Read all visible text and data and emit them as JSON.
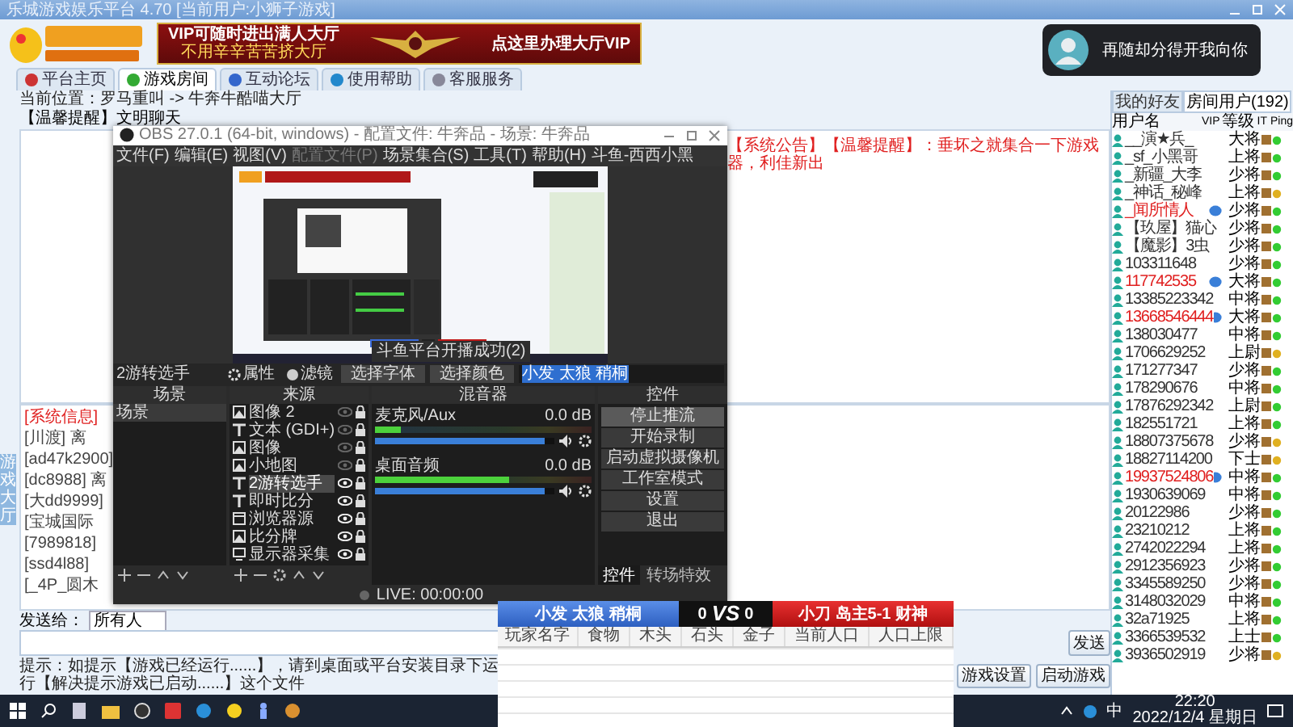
{
  "window": {
    "title": "乐城游戏娱乐平台 4.70 [当前用户:小狮子游戏]"
  },
  "banner": {
    "headline": "VIP可随时进出满人大厅",
    "subline": "不用辛辛苦苦挤大厅",
    "action": "点这里办理大厅VIP"
  },
  "tabs": [
    {
      "label": "平台主页",
      "selected": false
    },
    {
      "label": "游戏房间",
      "selected": true
    },
    {
      "label": "互动论坛",
      "selected": false
    },
    {
      "label": "使用帮助",
      "selected": false
    },
    {
      "label": "客服服务",
      "selected": false
    }
  ],
  "breadcrumb": "当前位置：罗马重叫 -> 牛奔牛酷喵大厅",
  "notice": "【温馨提醒】文明聊天",
  "side_tab": "游戏大厅",
  "announcement": "【系统公告】【温馨提醒】：垂坏之就集合一下游戏器，利佳新出",
  "chat": [
    {
      "text": "[系统信息]",
      "kind": "system"
    },
    {
      "text": "[川渡] 离",
      "kind": "user"
    },
    {
      "text": "[ad47k2900]",
      "kind": "user"
    },
    {
      "text": "[dc8988] 离",
      "kind": "user"
    },
    {
      "text": "[大dd9999]",
      "kind": "user"
    },
    {
      "text": "[宝城国际",
      "kind": "user"
    },
    {
      "text": "[7989818]",
      "kind": "user"
    },
    {
      "text": "[ssd4l88]",
      "kind": "user"
    },
    {
      "text": "[_4P_圆木",
      "kind": "user"
    }
  ],
  "send": {
    "label": "发送给：",
    "target": "所有人",
    "button": "发送"
  },
  "hint": "提示：如提示【游戏已经运行......】，请到桌面或平台安装目录下运行【解决提示游戏已启动......】这个文件",
  "buttons": [
    "游戏设置",
    "启动游戏"
  ],
  "notification": {
    "text": "再随却分得开我向你"
  },
  "user_panel": {
    "tabs": [
      {
        "label": "我的好友",
        "selected": false
      },
      {
        "label": "房间用户(192)",
        "selected": true
      }
    ],
    "columns": [
      "用户名",
      "VIP",
      "等级",
      "IT",
      "Ping"
    ],
    "users": [
      {
        "name": "__演★兵_",
        "vip": false,
        "level": "大将",
        "color": "#33cc33"
      },
      {
        "name": "_sf_小黑哥",
        "vip": false,
        "level": "上将",
        "color": "#33cc33"
      },
      {
        "name": "_新疆_大李",
        "vip": false,
        "level": "少将",
        "color": "#33cc33"
      },
      {
        "name": "_神话_秘峰",
        "vip": false,
        "level": "上将",
        "color": "#e0b020"
      },
      {
        "name": "_闻所情人",
        "vip": true,
        "level": "少将",
        "color": "#33cc33"
      },
      {
        "name": "【玖屋】猫心",
        "vip": false,
        "level": "少将",
        "color": "#33cc33"
      },
      {
        "name": "【魔影】3虫",
        "vip": false,
        "level": "少将",
        "color": "#33cc33"
      },
      {
        "name": "103311648",
        "vip": false,
        "level": "少将",
        "color": "#33cc33"
      },
      {
        "name": "117742535",
        "vip": true,
        "level": "大将",
        "color": "#33cc33"
      },
      {
        "name": "13385223342",
        "vip": false,
        "level": "中将",
        "color": "#33cc33"
      },
      {
        "name": "13668546444",
        "vip": true,
        "level": "大将",
        "color": "#33cc33"
      },
      {
        "name": "138030477",
        "vip": false,
        "level": "中将",
        "color": "#33cc33"
      },
      {
        "name": "1706629252",
        "vip": false,
        "level": "上尉",
        "color": "#e0b020"
      },
      {
        "name": "171277347",
        "vip": false,
        "level": "少将",
        "color": "#33cc33"
      },
      {
        "name": "178290676",
        "vip": false,
        "level": "中将",
        "color": "#33cc33"
      },
      {
        "name": "17876292342",
        "vip": false,
        "level": "上尉",
        "color": "#33cc33"
      },
      {
        "name": "182551721",
        "vip": false,
        "level": "上将",
        "color": "#33cc33"
      },
      {
        "name": "18807375678",
        "vip": false,
        "level": "少将",
        "color": "#e0b020"
      },
      {
        "name": "18827114200",
        "vip": false,
        "level": "下士",
        "color": "#e0b020"
      },
      {
        "name": "19937524806",
        "vip": true,
        "level": "中将",
        "color": "#33cc33"
      },
      {
        "name": "1930639069",
        "vip": false,
        "level": "中将",
        "color": "#33cc33"
      },
      {
        "name": "20122986",
        "vip": false,
        "level": "少将",
        "color": "#33cc33"
      },
      {
        "name": "23210212",
        "vip": false,
        "level": "上将",
        "color": "#33cc33"
      },
      {
        "name": "2742022294",
        "vip": false,
        "level": "上将",
        "color": "#33cc33"
      },
      {
        "name": "2912356923",
        "vip": false,
        "level": "少将",
        "color": "#33cc33"
      },
      {
        "name": "3345589250",
        "vip": false,
        "level": "少将",
        "color": "#33cc33"
      },
      {
        "name": "3148032029",
        "vip": false,
        "level": "中将",
        "color": "#33cc33"
      },
      {
        "name": "32a71925",
        "vip": false,
        "level": "上将",
        "color": "#33cc33"
      },
      {
        "name": "3366539532",
        "vip": false,
        "level": "上士",
        "color": "#33cc33"
      },
      {
        "name": "3936502919",
        "vip": false,
        "level": "少将",
        "color": "#e0b020"
      }
    ]
  },
  "obs": {
    "title": "OBS 27.0.1 (64-bit, windows) - 配置文件: 牛奔品 - 场景: 牛奔品",
    "menu": [
      {
        "label": "文件(F)",
        "disabled": false
      },
      {
        "label": "编辑(E)",
        "disabled": false
      },
      {
        "label": "视图(V)",
        "disabled": false
      },
      {
        "label": "配置文件(P)",
        "disabled": true
      },
      {
        "label": "场景集合(S)",
        "disabled": false
      },
      {
        "label": "工具(T)",
        "disabled": false
      },
      {
        "label": "帮助(H)",
        "disabled": false
      },
      {
        "label": "斗鱼-西西小黑",
        "disabled": false
      }
    ],
    "preview_toast": "斗鱼平台开播成功(2)",
    "source_bar": {
      "name": "2游转选手",
      "properties": "属性",
      "filters": "滤镜",
      "font": "选择字体",
      "color_button": "选择颜色",
      "value": "小发 太狼 稍桐"
    },
    "docks": [
      "场景",
      "来源",
      "混音器",
      "控件"
    ],
    "scenes": [
      {
        "name": "场景",
        "selected": true
      }
    ],
    "sources": [
      {
        "name": "图像 2",
        "kind": "image",
        "visible": false,
        "selected": false
      },
      {
        "name": "文本 (GDI+)",
        "kind": "text",
        "visible": false,
        "selected": false
      },
      {
        "name": "图像",
        "kind": "image",
        "visible": false,
        "selected": false
      },
      {
        "name": "小地图",
        "kind": "image",
        "visible": false,
        "selected": false
      },
      {
        "name": "2游转选手",
        "kind": "text",
        "visible": true,
        "selected": true
      },
      {
        "name": "即时比分",
        "kind": "text",
        "visible": true,
        "selected": false
      },
      {
        "name": "浏览器源",
        "kind": "browser",
        "visible": true,
        "selected": false
      },
      {
        "name": "比分牌",
        "kind": "image",
        "visible": true,
        "selected": false
      },
      {
        "name": "显示器采集",
        "kind": "display",
        "visible": true,
        "selected": false
      }
    ],
    "mixer": [
      {
        "name": "麦克风/Aux",
        "reading": "0.0 dB",
        "meter": {
          "level": 0.12
        },
        "level": 0.95
      },
      {
        "name": "桌面音频",
        "reading": "0.0 dB",
        "meter": {
          "level": 0.62
        },
        "level": 0.95
      }
    ],
    "controls": [
      {
        "label": "停止推流",
        "active": true
      },
      {
        "label": "开始录制",
        "active": false
      },
      {
        "label": "启动虚拟摄像机",
        "active": false
      },
      {
        "label": "工作室模式",
        "active": false
      },
      {
        "label": "设置",
        "active": false
      },
      {
        "label": "退出",
        "active": false
      }
    ],
    "control_tabs": [
      {
        "label": "控件",
        "selected": true
      },
      {
        "label": "转场特效",
        "selected": false
      }
    ],
    "status": "LIVE: 00:00:00"
  },
  "scoreboard": {
    "left": "小发 太狼 稍桐",
    "left_score": "0",
    "vs": "VS",
    "right_score": "0",
    "right": "小刀 岛主5-1 财神",
    "columns": [
      "玩家名字",
      "食物",
      "木头",
      "石头",
      "金子",
      "当前人口",
      "人口上限"
    ]
  },
  "taskbar": {
    "ime": "中",
    "time": "22:20",
    "date": "2022/12/4 星期日"
  }
}
